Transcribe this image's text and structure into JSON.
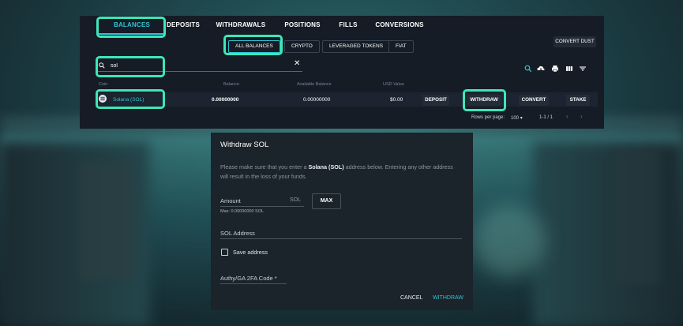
{
  "tabs": [
    {
      "label": "BALANCES",
      "active": true
    },
    {
      "label": "DEPOSITS"
    },
    {
      "label": "WITHDRAWALS"
    },
    {
      "label": "POSITIONS"
    },
    {
      "label": "FILLS"
    },
    {
      "label": "CONVERSIONS"
    }
  ],
  "filters": [
    {
      "label": "ALL BALANCES",
      "active": true
    },
    {
      "label": "CRYPTO"
    },
    {
      "label": "LEVERAGED TOKENS"
    },
    {
      "label": "FIAT"
    }
  ],
  "convert_dust_label": "CONVERT DUST",
  "search": {
    "value": "sol"
  },
  "columns": {
    "coin": "Coin",
    "balance": "Balance",
    "available": "Available Balance",
    "usd": "USD Value"
  },
  "row": {
    "coin": "Solana (SOL)",
    "balance": "0.00000000",
    "available": "0.00000000",
    "usd": "$0.00",
    "actions": [
      "DEPOSIT",
      "WITHDRAW",
      "CONVERT",
      "STAKE"
    ]
  },
  "pager": {
    "rows_label": "Rows per page:",
    "rows_value": "100",
    "range": "1-1 / 1"
  },
  "modal": {
    "title": "Withdraw SOL",
    "message_pre": "Please make sure that you enter a ",
    "message_bold": "Solana (SOL)",
    "message_post": " address below. Entering any other address will result in the loss of your funds.",
    "amount_label": "Amount",
    "amount_unit": "SOL",
    "amount_max": "Max: 0.00000000 SOL",
    "max_button": "MAX",
    "address_label": "SOL Address",
    "save_address_label": "Save address",
    "authy_label": "Authy/GA 2FA Code *",
    "cancel_label": "CANCEL",
    "withdraw_label": "WITHDRAW"
  },
  "colors": {
    "accent": "#2cc5d6",
    "highlight": "#3ee6b8",
    "panel": "#151c26"
  }
}
